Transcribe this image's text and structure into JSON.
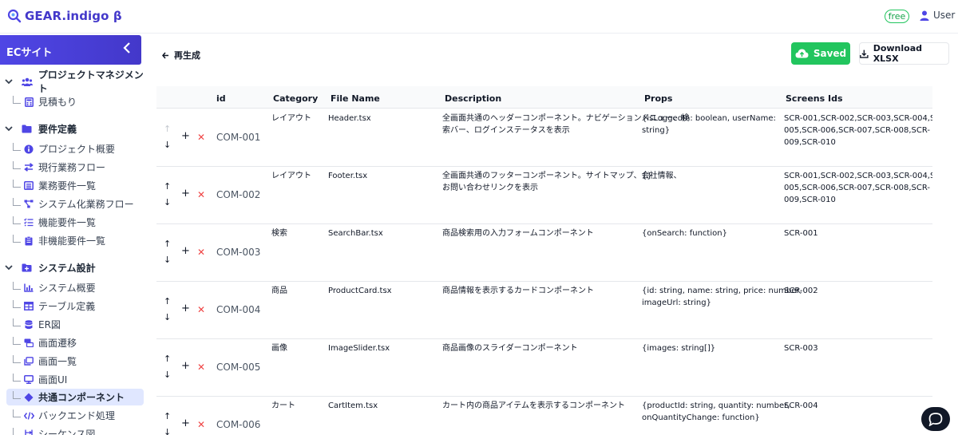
{
  "app": {
    "title": "GEAR.indigo β",
    "plan_badge": "free",
    "user_label": "User"
  },
  "sidebar": {
    "project": "ECサイト",
    "sections": [
      {
        "label": "プロジェクトマネジメント",
        "icon": "users-icon",
        "items": [
          {
            "label": "見積もり",
            "icon": "calculator-icon"
          }
        ]
      },
      {
        "label": "要件定義",
        "icon": "folder-icon",
        "items": [
          {
            "label": "プロジェクト概要",
            "icon": "info-icon"
          },
          {
            "label": "現行業務フロー",
            "icon": "swap-icon"
          },
          {
            "label": "業務要件一覧",
            "icon": "list-icon"
          },
          {
            "label": "システム化業務フロー",
            "icon": "flow-icon"
          },
          {
            "label": "機能要件一覧",
            "icon": "checklist-icon"
          },
          {
            "label": "非機能要件一覧",
            "icon": "clipboard-icon"
          }
        ]
      },
      {
        "label": "システム設計",
        "icon": "folder-plus-icon",
        "items": [
          {
            "label": "システム概要",
            "icon": "chart-icon"
          },
          {
            "label": "テーブル定義",
            "icon": "table-icon"
          },
          {
            "label": "ER図",
            "icon": "database-icon"
          },
          {
            "label": "画面遷移",
            "icon": "transition-icon"
          },
          {
            "label": "画面一覧",
            "icon": "windows-icon"
          },
          {
            "label": "画面UI",
            "icon": "monitor-icon"
          },
          {
            "label": "共通コンポーネント",
            "icon": "diamond-icon",
            "active": true
          },
          {
            "label": "バックエンド処理",
            "icon": "code-icon"
          },
          {
            "label": "シーケンス図",
            "icon": "sequence-icon"
          }
        ]
      }
    ]
  },
  "toolbar": {
    "regenerate_label": "再生成",
    "saved_label": "Saved",
    "download_label": "Download XLSX"
  },
  "table": {
    "columns": [
      "id",
      "Category",
      "File Name",
      "Description",
      "Props",
      "Screens Ids"
    ],
    "rows": [
      {
        "id": "COM-001",
        "category": "レイアウト",
        "file": "Header.tsx",
        "desc": [
          "全画面共通のヘッダーコンポーネント。ナビゲーションメニュー、検",
          "索バー、ログインステータスを表示"
        ],
        "props": [
          "{isLoggedIn: boolean, userName:",
          "string}"
        ],
        "screens": [
          "SCR-001,SCR-002,SCR-003,SCR-004,SCR-",
          "005,SCR-006,SCR-007,SCR-008,SCR-",
          "009,SCR-010"
        ]
      },
      {
        "id": "COM-002",
        "category": "レイアウト",
        "file": "Footer.tsx",
        "desc": [
          "全画面共通のフッターコンポーネント。サイトマップ、会社情報、",
          "お問い合わせリンクを表示"
        ],
        "props": [
          "{}"
        ],
        "screens": [
          "SCR-001,SCR-002,SCR-003,SCR-004,SCR-",
          "005,SCR-006,SCR-007,SCR-008,SCR-",
          "009,SCR-010"
        ]
      },
      {
        "id": "COM-003",
        "category": "検索",
        "file": "SearchBar.tsx",
        "desc": [
          "商品検索用の入力フォームコンポーネント"
        ],
        "props": [
          "{onSearch: function}"
        ],
        "screens": [
          "SCR-001"
        ]
      },
      {
        "id": "COM-004",
        "category": "商品",
        "file": "ProductCard.tsx",
        "desc": [
          "商品情報を表示するカードコンポーネント"
        ],
        "props": [
          "{id: string, name: string, price: number,",
          "imageUrl: string}"
        ],
        "screens": [
          "SCR-002"
        ]
      },
      {
        "id": "COM-005",
        "category": "画像",
        "file": "ImageSlider.tsx",
        "desc": [
          "商品画像のスライダーコンポーネント"
        ],
        "props": [
          "{images: string[]}"
        ],
        "screens": [
          "SCR-003"
        ]
      },
      {
        "id": "COM-006",
        "category": "カート",
        "file": "CartItem.tsx",
        "desc": [
          "カート内の商品アイテムを表示するコンポーネント"
        ],
        "props": [
          "{productId: string, quantity: number,",
          "onQuantityChange: function}"
        ],
        "screens": [
          "SCR-004"
        ]
      }
    ]
  },
  "colors": {
    "brand": "#4338ca",
    "accent": "#4f46e5",
    "success": "#22c55e",
    "danger": "#ef4444"
  }
}
